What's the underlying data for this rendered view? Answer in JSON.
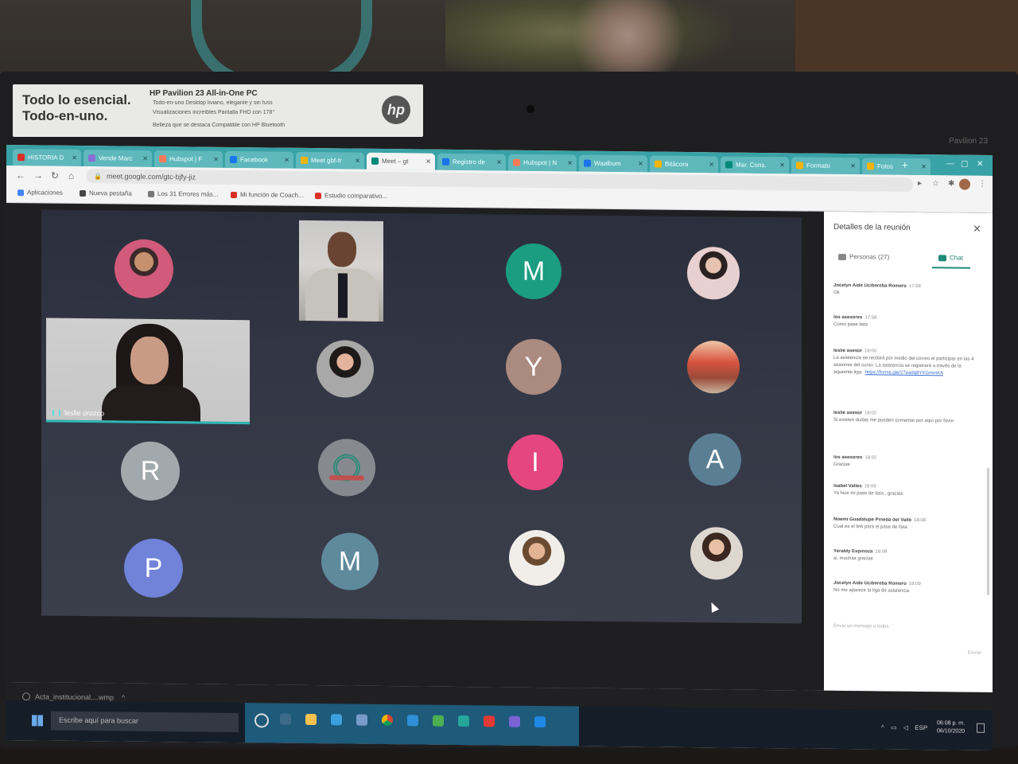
{
  "sticker": {
    "headline": "Todo lo esencial.\nTodo-en-uno.",
    "model": "HP Pavilion 23 All-in-One PC",
    "features": [
      "Todo-en-uno Desktop liviano, elegante y sin fuss",
      "Visualizaciones increíbles Pantalla FHD con 178°",
      "Belleza que se destaca Compatible con HP Bluetooth"
    ],
    "logo": "hp"
  },
  "brand": "Pavilion 23",
  "browser": {
    "tabs": [
      {
        "label": "HISTORIA D",
        "color": "#d93025"
      },
      {
        "label": "Vende Marc",
        "color": "#8a6dd6"
      },
      {
        "label": "Hubspot | F",
        "color": "#ff7a59"
      },
      {
        "label": "Facebook",
        "color": "#1877f2"
      },
      {
        "label": "Meet gbf-fr",
        "color": "#f4b400"
      },
      {
        "label": "Meet – gt",
        "color": "#00897b",
        "active": true
      },
      {
        "label": "Registro de",
        "color": "#1a73e8"
      },
      {
        "label": "Hubspot | N",
        "color": "#ff7a59"
      },
      {
        "label": "Waalbum",
        "color": "#1a73e8"
      },
      {
        "label": "Bitácora",
        "color": "#f4b400"
      },
      {
        "label": "Mar. Cons.",
        "color": "#00897b"
      },
      {
        "label": "Formato",
        "color": "#f4b400"
      },
      {
        "label": "Fotos",
        "color": "#f4b400"
      }
    ],
    "url": "meet.google.com/gtc-bjfy-jiz",
    "bookmarks": [
      {
        "label": "Aplicaciones",
        "color": "#4285f4"
      },
      {
        "label": "Nueva pestaña",
        "color": "#444444"
      },
      {
        "label": "Los 31 Errores más...",
        "color": "#777777"
      },
      {
        "label": "Mi función de Coach...",
        "color": "#d93025"
      },
      {
        "label": "Estudio comparativo...",
        "color": "#d93025"
      }
    ]
  },
  "meet": {
    "participants_initials": [
      "M",
      "Y",
      "I",
      "A",
      "R",
      "P",
      "M"
    ],
    "initial_colors": {
      "M1": "#1a9d80",
      "Y": "#ab8a80",
      "I": "#e5467f",
      "A": "#5a7f94",
      "R": "#a2a9ad",
      "P": "#7182d9",
      "M2": "#5e8a9c"
    },
    "spotlight_name": "leslie orozco",
    "side_panel": {
      "title": "Detalles de la reunión",
      "tab_people": "Personas (27)",
      "tab_chat": "Chat",
      "messages": [
        {
          "sender": "Jocelyn Aide Ucibereba Romero",
          "time": "17:58",
          "text": "Ok"
        },
        {
          "sender": "los asesores",
          "time": "17:58",
          "text": "Como pase lista"
        },
        {
          "sender": "leslie asesor",
          "time": "18:00",
          "text": "La asistencia se recibirá por medio del correo el participar en las 4 sesiones del curso. La asistencia se registrará a través de la siguiente liga:",
          "link": "https://forms.gle/27eadq8YKGmmKA"
        },
        {
          "sender": "leslie asesor",
          "time": "18:02",
          "text": "Si existen dudas me pueden comentar por aquí por favor"
        },
        {
          "sender": "los asesores",
          "time": "18:02",
          "text": "Gracias"
        },
        {
          "sender": "Isabel Valles",
          "time": "18:06",
          "text": "Ya hice mi pase de lista , gracias"
        },
        {
          "sender": "Noemi Guadalupe Pineda del Valle",
          "time": "18:08",
          "text": "Cual es el link para el pase de lista"
        },
        {
          "sender": "Yeraldy Espinoza",
          "time": "18:08",
          "text": "si, muchas gracias"
        },
        {
          "sender": "Jocelyn Aide Ucibereba Romero",
          "time": "18:09",
          "text": "No me aparece la liga de asistencia"
        }
      ],
      "input_placeholder": "Envía un mensaje a todos",
      "send_label": "Enviar"
    }
  },
  "downloads": {
    "file": "Acta_institucional....wmp"
  },
  "taskbar": {
    "search_placeholder": "Escribe aquí para buscar",
    "lang": "ESP",
    "time": "06:08 p. m.",
    "date": "06/10/2020"
  }
}
